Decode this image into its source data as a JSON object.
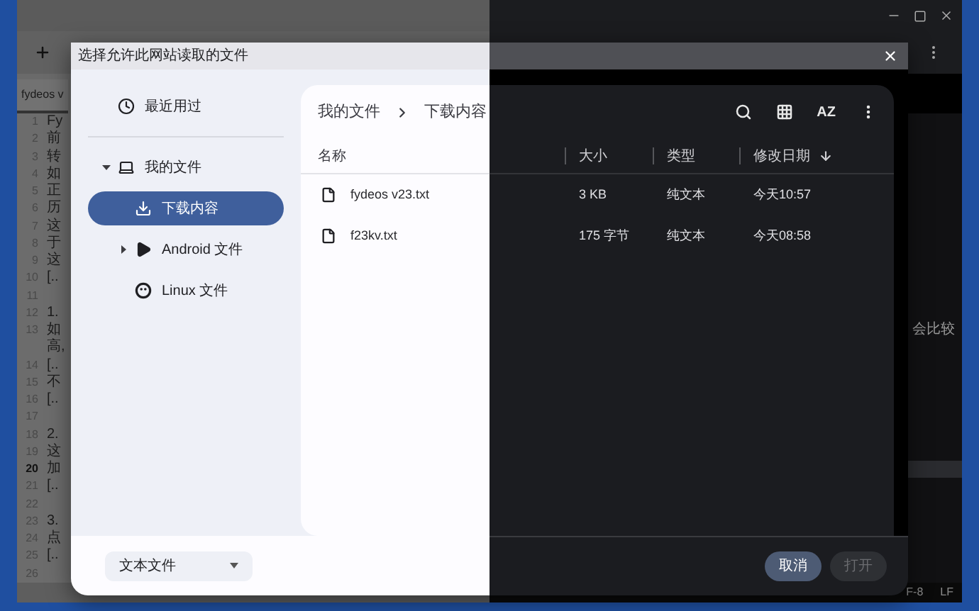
{
  "editor": {
    "tab": "fydeos v",
    "lines": [
      {
        "number": "1",
        "text": "Fy",
        "current": false
      },
      {
        "number": "2",
        "text": "前",
        "current": false
      },
      {
        "number": "3",
        "text": "转",
        "current": false
      },
      {
        "number": "4",
        "text": "如",
        "current": false
      },
      {
        "number": "5",
        "text": "正",
        "current": false
      },
      {
        "number": "6",
        "text": "历",
        "current": false
      },
      {
        "number": "7",
        "text": "这",
        "current": false
      },
      {
        "number": "8",
        "text": "于",
        "current": false
      },
      {
        "number": "9",
        "text": "这",
        "current": false
      },
      {
        "number": "10",
        "text": "[..",
        "current": false
      },
      {
        "number": "11",
        "current": false
      },
      {
        "number": "12",
        "text": "1.",
        "current": false
      },
      {
        "number": "13",
        "text": "如",
        "tail": "会比较",
        "wrap": "高,",
        "current": false
      },
      {
        "number": "14",
        "text": "[..",
        "current": false
      },
      {
        "number": "15",
        "text": "不",
        "current": false
      },
      {
        "number": "16",
        "text": "[..",
        "current": false
      },
      {
        "number": "17",
        "current": false
      },
      {
        "number": "18",
        "text": "2.",
        "current": false
      },
      {
        "number": "19",
        "text": "这",
        "current": false
      },
      {
        "number": "20",
        "text": "加",
        "current": true
      },
      {
        "number": "21",
        "text": "[..",
        "current": false
      },
      {
        "number": "22",
        "current": false
      },
      {
        "number": "23",
        "text": "3.",
        "current": false
      },
      {
        "number": "24",
        "text": "点",
        "current": false
      },
      {
        "number": "25",
        "text": "[..",
        "current": false
      },
      {
        "number": "26",
        "current": false
      }
    ],
    "status": [
      "F-8",
      "LF"
    ]
  },
  "dialog": {
    "title": "选择允许此网站读取的文件",
    "sidebar": [
      {
        "label": "最近用过",
        "kind": "recent",
        "selected": false
      },
      {
        "label": "我的文件",
        "kind": "computer",
        "selected": false,
        "expanded": true,
        "children": [
          {
            "label": "下载内容",
            "kind": "download",
            "selected": true
          },
          {
            "label": "Android 文件",
            "kind": "android",
            "selected": false,
            "expanded": false
          },
          {
            "label": "Linux 文件",
            "kind": "linux",
            "selected": false
          }
        ]
      }
    ],
    "breadcrumb": [
      "我的文件",
      "下载内容"
    ],
    "sort_label": "AZ",
    "columns": [
      {
        "label": "名称",
        "sorted": false
      },
      {
        "label": "大小",
        "sorted": false
      },
      {
        "label": "类型",
        "sorted": false
      },
      {
        "label": "修改日期",
        "sorted": true
      }
    ],
    "files": [
      {
        "name": "fydeos v23.txt",
        "size": "3 KB",
        "type": "纯文本",
        "modified": "今天10:57"
      },
      {
        "name": "f23kv.txt",
        "size": "175 字节",
        "type": "纯文本",
        "modified": "今天08:58"
      }
    ],
    "filter": "文本文件",
    "buttons": [
      {
        "label": "取消",
        "disabled": false
      },
      {
        "label": "打开",
        "disabled": true
      }
    ]
  }
}
